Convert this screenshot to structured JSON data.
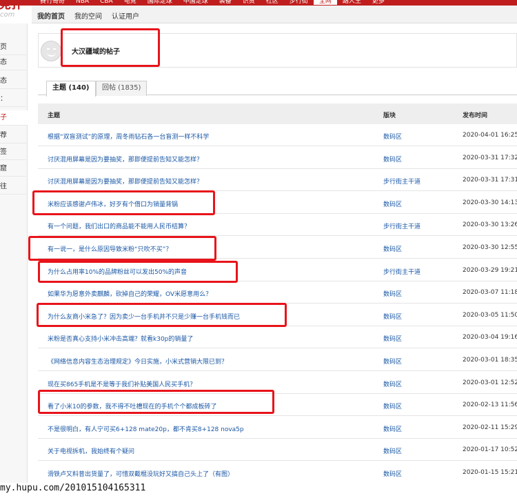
{
  "topnav": {
    "items": [
      "赛竹哥奇",
      "NBA",
      "CBA",
      "电竞",
      "国际足球",
      "中国足球",
      "装备",
      "识货",
      "社区",
      "步行街",
      "全网",
      "路人王",
      "更多"
    ],
    "active_index": 10
  },
  "logo": {
    "line1": "竞扑",
    "line2": "com"
  },
  "subnav": {
    "items": [
      "我的首页",
      "我的空间",
      "认证用户"
    ]
  },
  "leftnav": {
    "items": [
      "页",
      "态",
      "态",
      "：",
      "子",
      "荐",
      "签",
      "窟",
      "往"
    ],
    "active_index": 4
  },
  "profile": {
    "title": "大汉疆域的帖子"
  },
  "tabs": [
    {
      "label": "主题 (140)"
    },
    {
      "label": "回帖 (1835)"
    }
  ],
  "table": {
    "headers": {
      "topic": "主题",
      "forum": "版块",
      "time": "发布时间"
    },
    "rows": [
      {
        "topic": "根据“双盲测试”的原理，周冬雨钻石各一台盲测一样不科学",
        "forum": "数码区",
        "time": "2020-04-01 16:25:"
      },
      {
        "topic": "讨厌混用屏幕是因为要抽奖，那即便提前告知又能怎样？",
        "forum": "数码区",
        "time": "2020-03-31 17:32:"
      },
      {
        "topic": "讨厌混用屏幕是因为要抽奖，那即便提前告知又能怎样？",
        "forum": "步行街主干道",
        "time": "2020-03-31 17:31:"
      },
      {
        "topic": "米粉应该感谢卢伟冰，好歹有个借口为销量背锅",
        "forum": "数码区",
        "time": "2020-03-30 14:13:"
      },
      {
        "topic": "有一个问题，我们出口的商品能不能用人民币结算？",
        "forum": "步行街主干道",
        "time": "2020-03-30 13:26:"
      },
      {
        "topic": "有一说一，是什么原因导致米粉“只吹不买”？",
        "forum": "数码区",
        "time": "2020-03-30 12:55:"
      },
      {
        "topic": "为什么占用率10%的品牌粉丝可以发出50%的声音",
        "forum": "步行街主干道",
        "time": "2020-03-29 19:21:"
      },
      {
        "topic": "如果华为愿意外卖麒麟，砍掉自己的荣耀，OV米愿意用么？",
        "forum": "数码区",
        "time": "2020-03-07 11:18:"
      },
      {
        "topic": "为什么友商小米急了？因为卖少一台手机并不只是少赚一台手机钱而已",
        "forum": "数码区",
        "time": "2020-03-05 11:50:"
      },
      {
        "topic": "米粉是否真心支持小米冲击高端？就看k30p的销量了",
        "forum": "数码区",
        "time": "2020-03-04 19:16:"
      },
      {
        "topic": "《网络信息内容生态治理规定》今日实施，小米式营销大限已到？",
        "forum": "数码区",
        "time": "2020-03-01 18:35:"
      },
      {
        "topic": "现在买865手机是不是等于我们补贴美国人民买手机？",
        "forum": "数码区",
        "time": "2020-03-01 12:52:"
      },
      {
        "topic": "看了小米10的参数，我不得不吐槽现在的手机个个都成板砖了",
        "forum": "数码区",
        "time": "2020-02-13 11:56:"
      },
      {
        "topic": "不是很明白，有人宁可买6+128 mate20p，都不肯买8+128 nova5p",
        "forum": "数码区",
        "time": "2020-02-11 15:29:"
      },
      {
        "topic": "关于电视拆机，我始终有个疑问",
        "forum": "数码区",
        "time": "2020-01-17 10:52:"
      },
      {
        "topic": "滑铁卢又料昔出货量了，可惜双截棍没玩好又搞自己头上了（有图）",
        "forum": "数码区",
        "time": "2020-01-15 15:21:"
      }
    ]
  },
  "footer": {
    "text": "my.hupu.com/201015104165311"
  },
  "colors": {
    "brand": "#c01e1e",
    "link": "#1a57a5",
    "highlight": "#e8131a"
  }
}
